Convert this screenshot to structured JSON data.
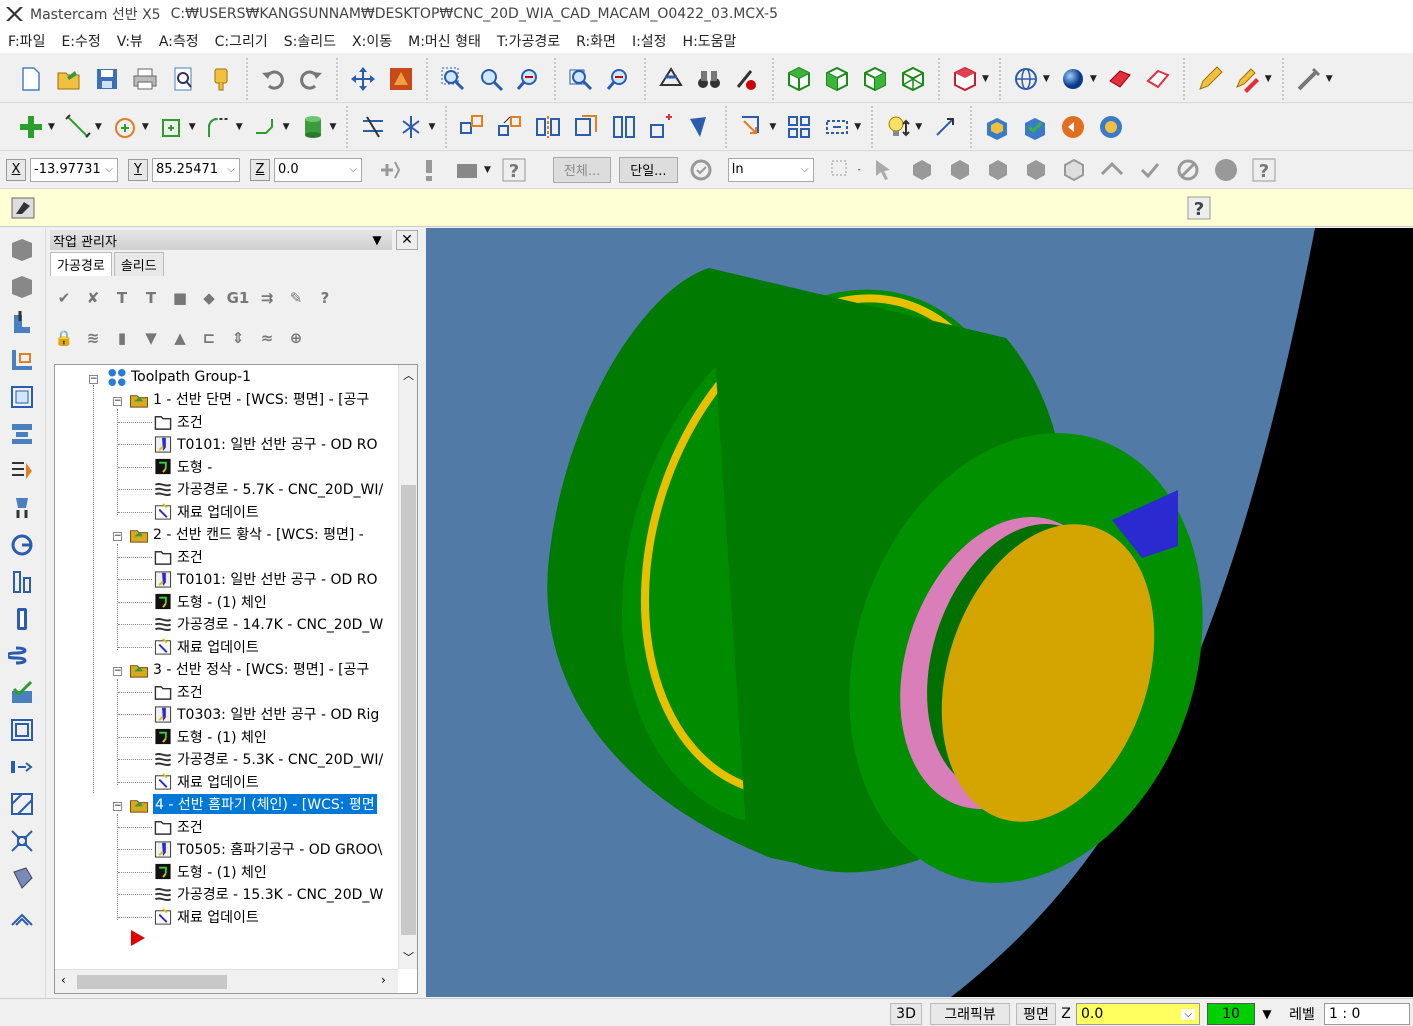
{
  "title": {
    "app": "Mastercam 선반 X5",
    "path": "C:₩USERS₩KANGSUNNAM₩DESKTOP₩CNC_20D_WIA_CAD_MACAM_O0422_03.MCX-5"
  },
  "menu": [
    "F:파일",
    "E:수정",
    "V:뷰",
    "A:측정",
    "C:그리기",
    "S:솔리드",
    "X:이동",
    "M:머신 형태",
    "T:가공경로",
    "R:화면",
    "I:설정",
    "H:도움말"
  ],
  "coords": {
    "x_label": "X",
    "x_value": "-13.97731",
    "y_label": "Y",
    "y_value": "85.25471",
    "z_label": "Z",
    "z_value": "0.0"
  },
  "selection": {
    "all_label": "전체...",
    "single_label": "단일...",
    "mode_value": "In"
  },
  "panel": {
    "title": "작업 관리자",
    "close": "✕",
    "tabs": [
      "가공경로",
      "솔리드"
    ],
    "g1_label": "G1"
  },
  "tree": {
    "group": "Toolpath Group-1",
    "ops": [
      {
        "title": "1 - 선반 단면 - [WCS: 평면] - [공구",
        "children": [
          "조건",
          "T0101: 일반 선반 공구 - OD RO",
          "도형 -",
          "가공경로 - 5.7K - CNC_20D_WI/",
          "재료 업데이트"
        ]
      },
      {
        "title": "2 - 선반 캔드 황삭 - [WCS: 평면] -",
        "children": [
          "조건",
          "T0101: 일반 선반 공구 - OD RO",
          "도형 - (1) 체인",
          "가공경로 - 14.7K - CNC_20D_W",
          "재료 업데이트"
        ]
      },
      {
        "title": "3 - 선반 정삭 - [WCS: 평면] - [공구",
        "children": [
          "조건",
          "T0303: 일반 선반 공구 - OD Rig",
          "도형 - (1) 체인",
          "가공경로 - 5.3K - CNC_20D_WI/",
          "재료 업데이트"
        ]
      },
      {
        "title": "4 - 선반 홈파기 (체인) - [WCS: 평면",
        "children": [
          "조건",
          "T0505: 홈파기공구 - OD GROO\\",
          "도형 - (1) 체인",
          "가공경로 - 15.3K - CNC_20D_W",
          "재료 업데이트"
        ]
      }
    ],
    "selected_index": 3
  },
  "status": {
    "view3d": "3D",
    "gview": "그래픽뷰",
    "plane": "평면",
    "z_label": "Z",
    "z_value": "0.0",
    "color_value": "10",
    "level_label": "레벨",
    "level_value": "1 : 0"
  },
  "colors": {
    "viewport_bg": "#517ba6",
    "part_green": "#008c00",
    "part_yellow": "#d4a500",
    "part_pink": "#e08cc0",
    "part_blue": "#2a2ad0",
    "selection": "#0078d7"
  }
}
